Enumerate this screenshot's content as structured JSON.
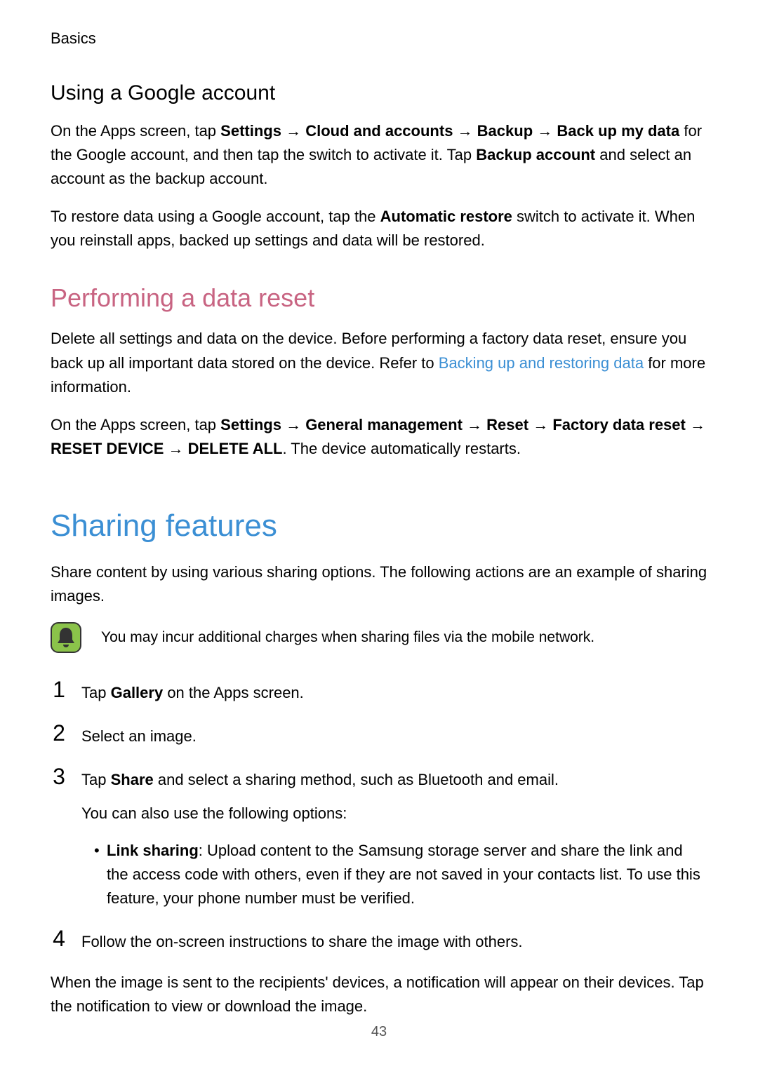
{
  "header": {
    "section_label": "Basics"
  },
  "subheading1": "Using a Google account",
  "para1_parts": {
    "a": "On the Apps screen, tap ",
    "settings": "Settings",
    "arrow1": " → ",
    "cloud": "Cloud and accounts",
    "arrow2": " → ",
    "backup": "Backup",
    "arrow3": " → ",
    "backupmy": "Back up my data",
    "b": " for the Google account, and then tap the switch to activate it. Tap ",
    "backupacc": "Backup account",
    "c": " and select an account as the backup account."
  },
  "para2_parts": {
    "a": "To restore data using a Google account, tap the ",
    "auto": "Automatic restore",
    "b": " switch to activate it. When you reinstall apps, backed up settings and data will be restored."
  },
  "pink_heading": "Performing a data reset",
  "para3_parts": {
    "a": "Delete all settings and data on the device. Before performing a factory data reset, ensure you back up all important data stored on the device. Refer to ",
    "link": "Backing up and restoring data",
    "b": " for more information."
  },
  "para4_parts": {
    "a": "On the Apps screen, tap ",
    "settings": "Settings",
    "arrow1": " → ",
    "gm": "General management",
    "arrow2": " → ",
    "reset": "Reset",
    "arrow3": " → ",
    "fdr": "Factory data reset",
    "arrow4": " → ",
    "rd": "RESET DEVICE",
    "arrow5": " → ",
    "da": "DELETE ALL",
    "b": ". The device automatically restarts."
  },
  "major_heading": "Sharing features",
  "share_intro": "Share content by using various sharing options. The following actions are an example of sharing images.",
  "note_text": "You may incur additional charges when sharing files via the mobile network.",
  "steps": {
    "s1": {
      "num": "1",
      "a": "Tap ",
      "strong": "Gallery",
      "b": " on the Apps screen."
    },
    "s2": {
      "num": "2",
      "text": "Select an image."
    },
    "s3": {
      "num": "3",
      "a": "Tap ",
      "strong": "Share",
      "b": " and select a sharing method, such as Bluetooth and email.",
      "sub": "You can also use the following options:",
      "bullet_label": "Link sharing",
      "bullet_rest": ": Upload content to the Samsung storage server and share the link and the access code with others, even if they are not saved in your contacts list. To use this feature, your phone number must be verified."
    },
    "s4": {
      "num": "4",
      "text": "Follow the on-screen instructions to share the image with others."
    }
  },
  "closing_para": "When the image is sent to the recipients' devices, a notification will appear on their devices. Tap the notification to view or download the image.",
  "page_number": "43"
}
